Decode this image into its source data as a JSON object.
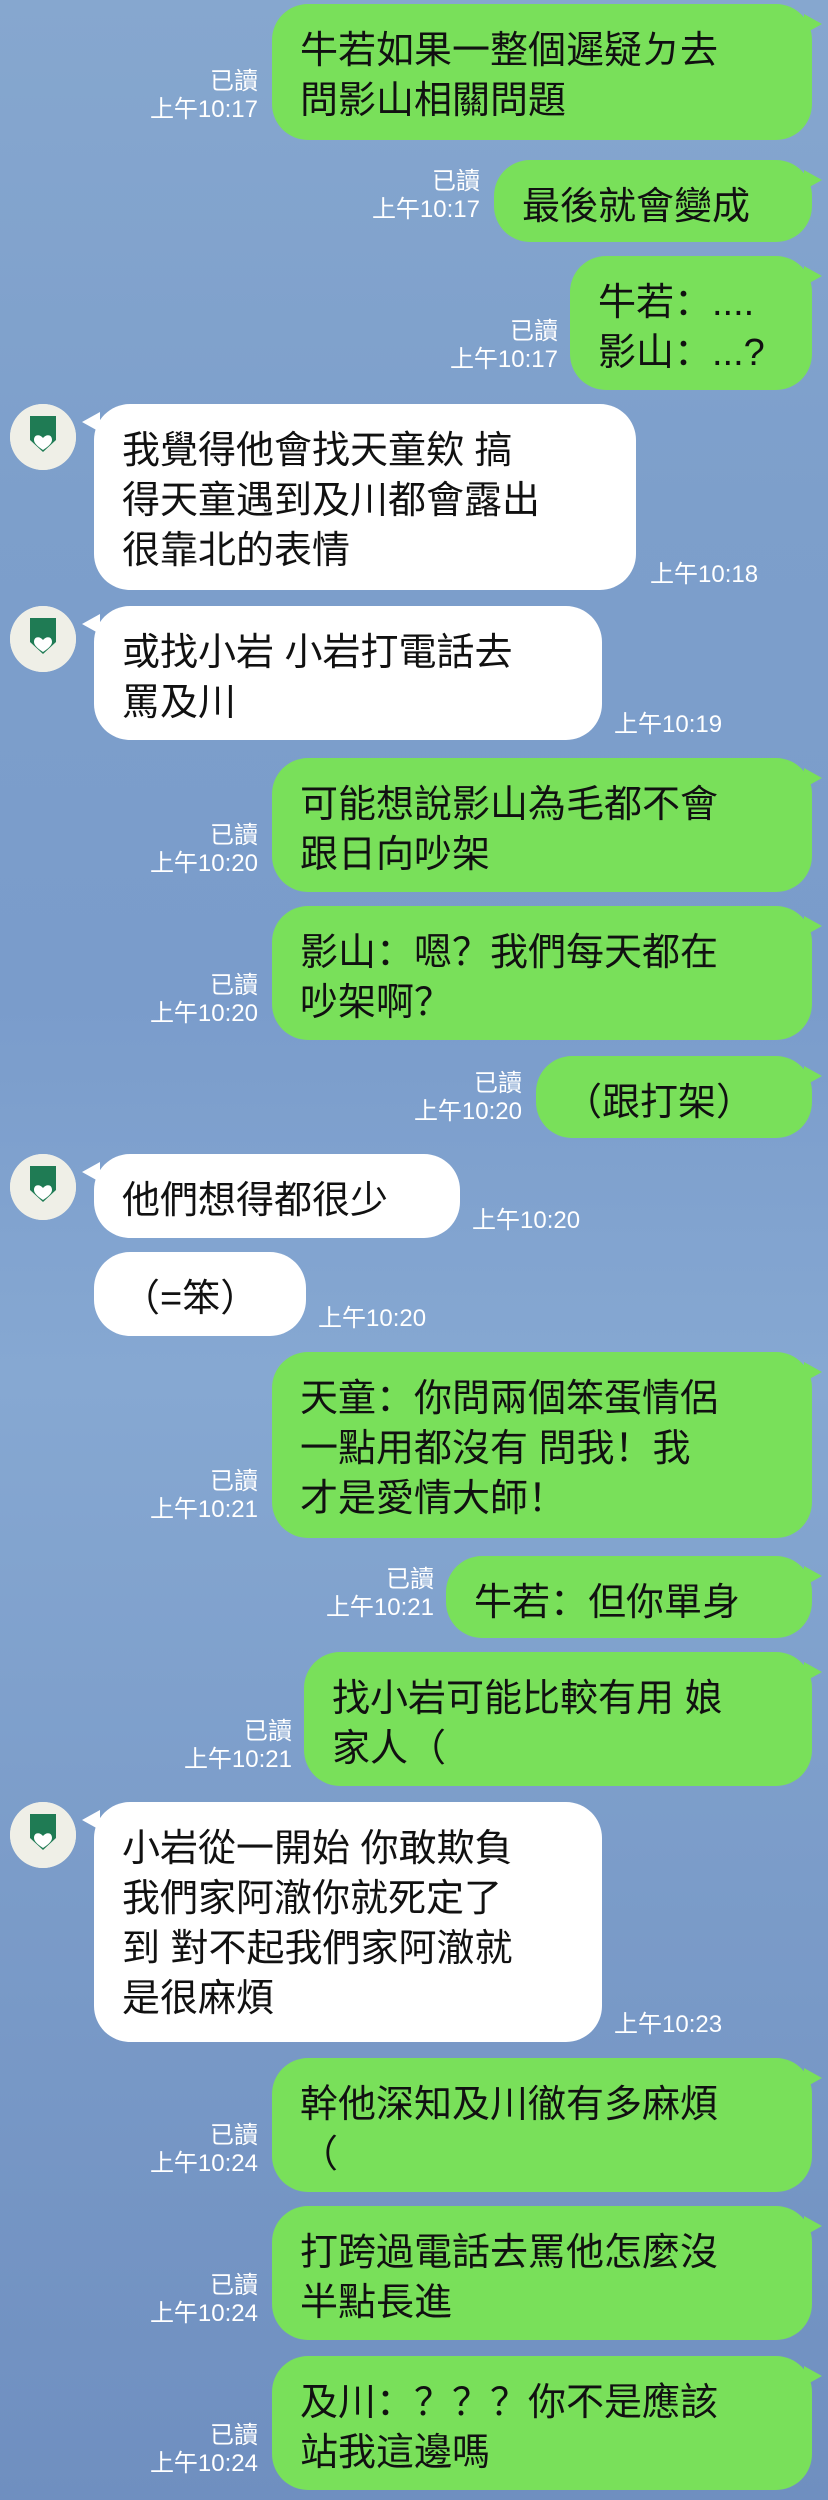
{
  "read_label": "已讀",
  "colors": {
    "outgoing": "#79e05a",
    "incoming": "#ffffff",
    "avatar_green": "#1f7b54"
  },
  "messages": [
    {
      "dir": "out",
      "text": "牛若如果一整個遲疑ㄉ去\n問影山相關問題",
      "time": "上午10:17"
    },
    {
      "dir": "out",
      "text": "最後就會變成",
      "time": "上午10:17"
    },
    {
      "dir": "out",
      "text": "牛若：....\n影山：...?",
      "time": "上午10:17"
    },
    {
      "dir": "in",
      "text": "我覺得他會找天童欸 搞\n得天童遇到及川都會露出\n很靠北的表情",
      "time": "上午10:18"
    },
    {
      "dir": "in",
      "text": "或找小岩 小岩打電話去\n罵及川",
      "time": "上午10:19"
    },
    {
      "dir": "out",
      "text": "可能想說影山為毛都不會\n跟日向吵架",
      "time": "上午10:20"
    },
    {
      "dir": "out",
      "text": "影山：嗯？我們每天都在\n吵架啊？",
      "time": "上午10:20"
    },
    {
      "dir": "out",
      "text": "（跟打架）",
      "time": "上午10:20"
    },
    {
      "dir": "in",
      "text": "他們想得都很少",
      "time": "上午10:20"
    },
    {
      "dir": "in",
      "text": "（=笨）",
      "time": "上午10:20"
    },
    {
      "dir": "out",
      "text": "天童：你問兩個笨蛋情侶\n一點用都沒有 問我！我\n才是愛情大師！",
      "time": "上午10:21"
    },
    {
      "dir": "out",
      "text": "牛若：但你單身",
      "time": "上午10:21"
    },
    {
      "dir": "out",
      "text": "找小岩可能比較有用 娘\n家人（",
      "time": "上午10:21"
    },
    {
      "dir": "in",
      "text": "小岩從一開始 你敢欺負\n我們家阿澈你就死定了\n到 對不起我們家阿澈就\n是很麻煩",
      "time": "上午10:23"
    },
    {
      "dir": "out",
      "text": "幹他深知及川徹有多麻煩\n（",
      "time": "上午10:24"
    },
    {
      "dir": "out",
      "text": "打跨過電話去罵他怎麼沒\n半點長進",
      "time": "上午10:24"
    },
    {
      "dir": "out",
      "text": "及川：？？？你不是應該\n站我這邊嗎",
      "time": "上午10:24"
    }
  ]
}
